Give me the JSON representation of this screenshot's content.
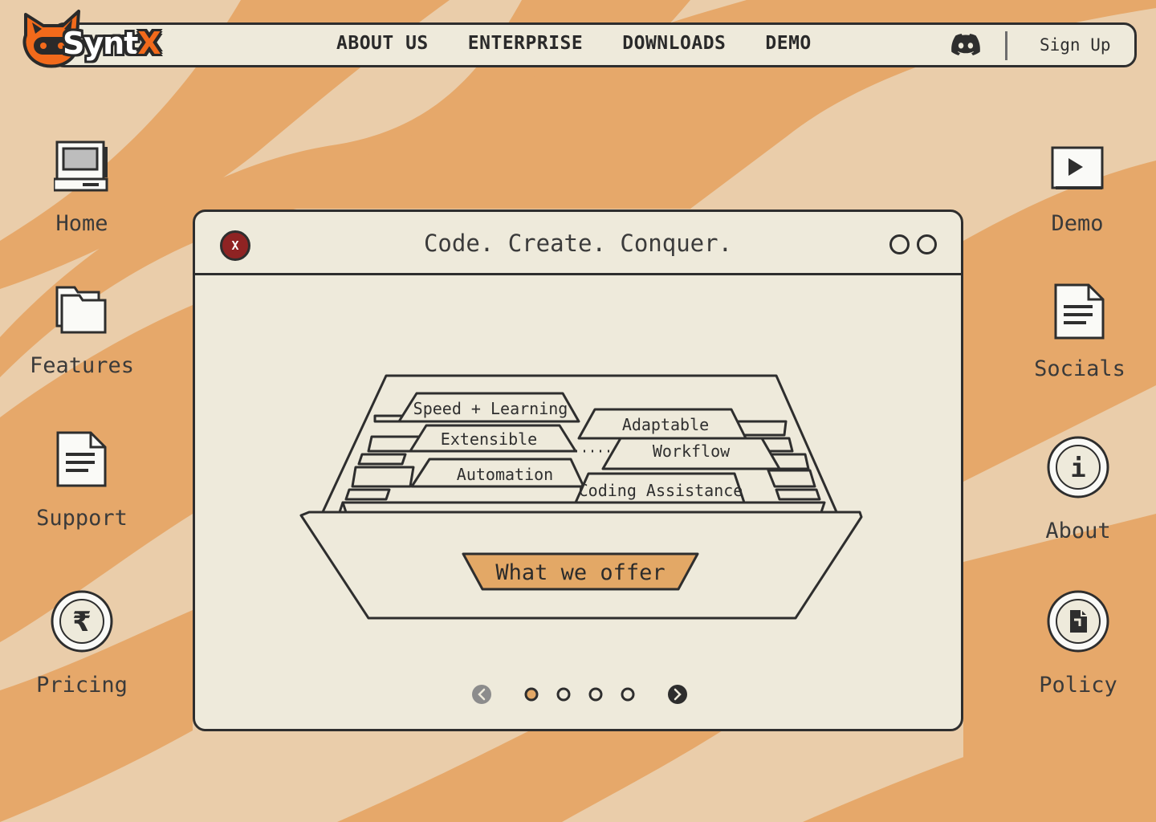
{
  "brand": {
    "logo_text_main": "Synt",
    "logo_text_accent": "X",
    "logo_icon": "fox-gamepad-icon",
    "accent_color": "#f26a1b"
  },
  "nav": {
    "links": [
      "ABOUT US",
      "ENTERPRISE",
      "DOWNLOADS",
      "DEMO"
    ],
    "discord_icon": "discord-icon",
    "signup_label": "Sign Up"
  },
  "desktop": {
    "left": [
      {
        "label": "Home",
        "icon": "computer-icon"
      },
      {
        "label": "Features",
        "icon": "folder-icon"
      },
      {
        "label": "Support",
        "icon": "document-icon"
      },
      {
        "label": "Pricing",
        "icon": "rupee-coin-icon"
      }
    ],
    "right": [
      {
        "label": "Demo",
        "icon": "play-icon"
      },
      {
        "label": "Socials",
        "icon": "document-icon"
      },
      {
        "label": "About",
        "icon": "info-coin-icon"
      },
      {
        "label": "Policy",
        "icon": "policy-coin-icon"
      }
    ]
  },
  "window": {
    "close_label": "X",
    "title": "Code. Create. Conquer.",
    "cabinet": {
      "tabs": [
        "Speed + Learning",
        "Extensible",
        "Automation",
        "Adaptable",
        "Workflow",
        "Coding Assistance"
      ],
      "drawer_label": "What we offer"
    },
    "pager": {
      "page_count": 4,
      "active_index": 0,
      "active_color": "#e3a866"
    }
  },
  "colors": {
    "stripe_dark": "#e6a86a",
    "stripe_light": "#eacdaa",
    "panel": "#eeeadb",
    "outline": "#2e2e2e",
    "close_button": "#8f2323"
  }
}
